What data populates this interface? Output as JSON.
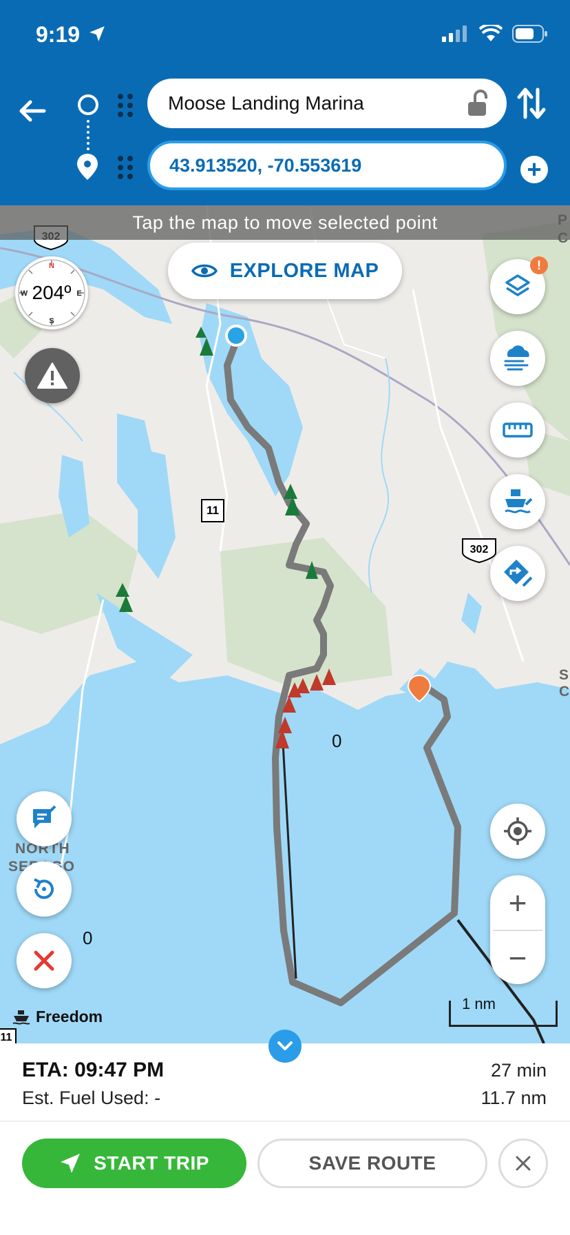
{
  "status_bar": {
    "time": "9:19"
  },
  "route": {
    "origin": "Moose Landing Marina",
    "destination": "43.913520, -70.553619"
  },
  "map": {
    "hint": "Tap the map to move selected point",
    "explore_label": "EXPLORE MAP",
    "compass_heading": "204º",
    "compass_n": "N",
    "compass_s": "S",
    "compass_e": "E",
    "compass_w": "W",
    "layers_badge": "!",
    "zoom_in": "+",
    "zoom_out": "−",
    "scale_label": "1 nm",
    "vessel_name": "Freedom",
    "route_shield_302_top": "302",
    "route_shield_302_right": "302",
    "route_shield_11": "11",
    "route_shield_11_bottom": "11",
    "depth_label_1": "0",
    "depth_label_2": "0",
    "town_north": "NORTH",
    "town_sebago": "SEBAGO",
    "edge_label_s": "S",
    "edge_label_c": "C",
    "edge_label_c2": "C",
    "edge_label_p": "P",
    "colors": {
      "water": "#9fd9f7",
      "route": "#7a7a7a",
      "accent": "#0a6bb5",
      "start": "#36b73a"
    }
  },
  "trip": {
    "eta": "ETA: 09:47 PM",
    "fuel": "Est. Fuel Used: -",
    "duration": "27 min",
    "distance": "11.7 nm",
    "start_label": "START TRIP",
    "save_label": "SAVE ROUTE"
  }
}
